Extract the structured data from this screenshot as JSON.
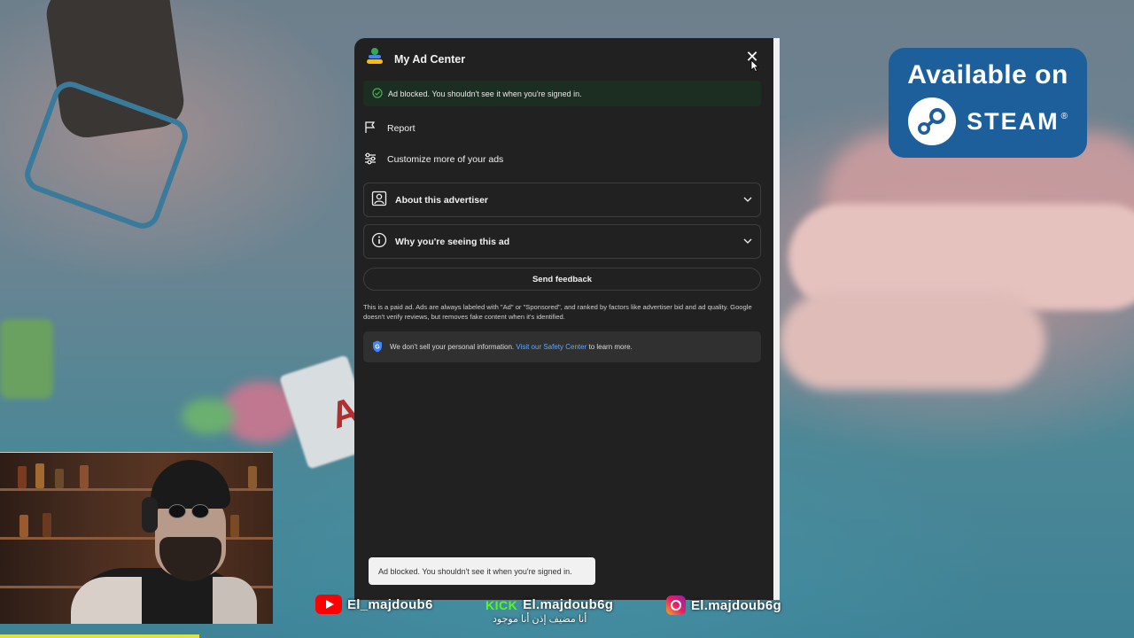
{
  "ad_center": {
    "title": "My Ad Center",
    "banner_text": "Ad blocked. You shouldn't see it when you're signed in.",
    "report_label": "Report",
    "customize_label": "Customize more of your ads",
    "about_advertiser_label": "About this advertiser",
    "why_seeing_label": "Why you're seeing this ad",
    "send_feedback_label": "Send feedback",
    "paid_note": "This is a paid ad. Ads are always labeled with \"Ad\" or \"Sponsored\", and ranked by factors like advertiser bid and ad quality. Google doesn't verify reviews, but removes fake content when it's identified.",
    "privacy_text_before": "We don't sell your personal information.",
    "privacy_link": "Visit our Safety Center",
    "privacy_text_after": "to learn more."
  },
  "toast": {
    "text": "Ad blocked. You shouldn't see it when you're signed in."
  },
  "steam_badge": {
    "available_text": "Available on",
    "brand_text": "STEAM",
    "registered_mark": "®"
  },
  "socials": {
    "youtube_handle": "El_majdoub6",
    "kick_label": "KICK",
    "kick_handle": "El.majdoub6g",
    "kick_subtitle": "أنا مضيف إذن أنا موجود",
    "instagram_handle": "El.majdoub6g"
  },
  "colors": {
    "panel_bg": "#212121",
    "success_bg": "#1c2e22",
    "success_icon": "#4caf50",
    "link": "#5fa8ff",
    "steam_blue": "#1d5f9a",
    "youtube_red": "#ff0000",
    "kick_green": "#53fc18"
  },
  "icons": {
    "logo": "my-ad-center-logo",
    "close": "close-icon",
    "check": "check-circle-icon",
    "report": "flag-icon",
    "customize": "sliders-icon",
    "advertiser": "person-badge-icon",
    "info": "info-icon",
    "chevron": "chevron-down-icon",
    "google_shield": "google-shield-icon"
  }
}
